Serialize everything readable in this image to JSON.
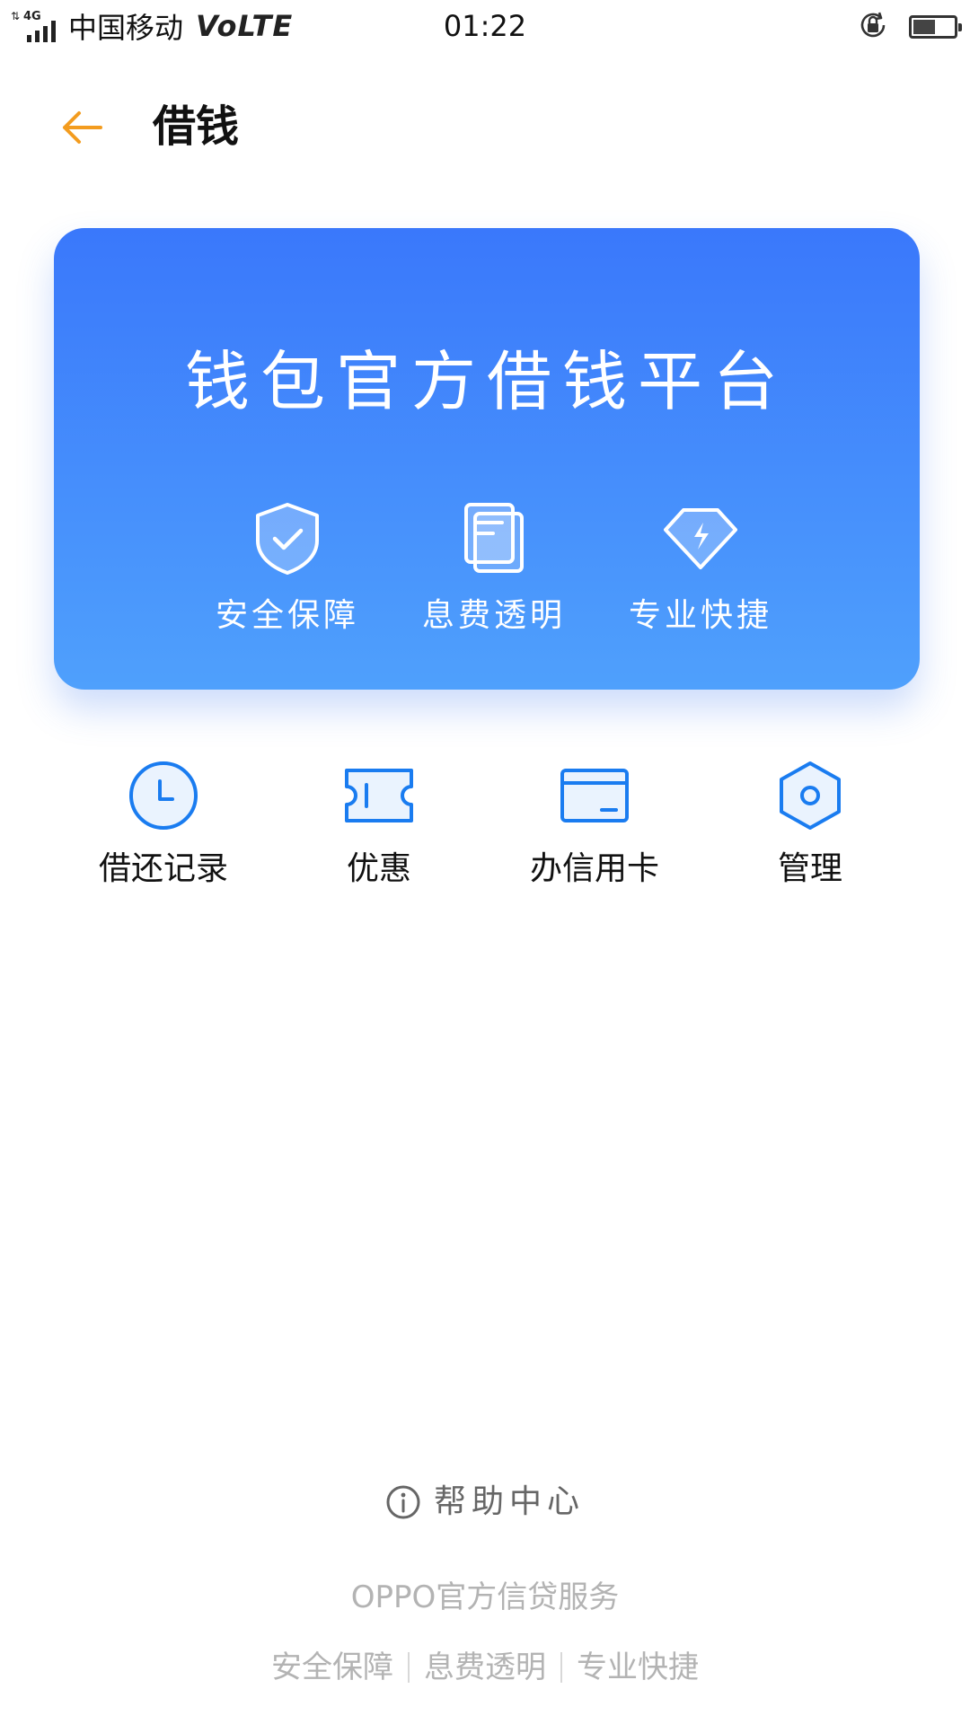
{
  "status_bar": {
    "network_type": "4G",
    "network_arrows": "⇅",
    "carrier": "中国移动",
    "volte": "VoLTE",
    "time": "01:22",
    "battery_level": 0.55
  },
  "header": {
    "title": "借钱",
    "back_icon": "back-arrow-icon",
    "back_color": "#f39c1f"
  },
  "banner": {
    "title": "钱包官方借钱平台",
    "features": [
      {
        "label": "安全保障",
        "icon": "shield-check-icon"
      },
      {
        "label": "息费透明",
        "icon": "document-icon"
      },
      {
        "label": "专业快捷",
        "icon": "diamond-lightning-icon"
      }
    ],
    "gradient": [
      "#3a78fb",
      "#4fa0fc"
    ]
  },
  "quick_actions": [
    {
      "label": "借还记录",
      "icon": "clock-icon"
    },
    {
      "label": "优惠",
      "icon": "coupon-icon"
    },
    {
      "label": "办信用卡",
      "icon": "credit-card-icon"
    },
    {
      "label": "管理",
      "icon": "settings-hexagon-icon"
    }
  ],
  "accent_color": "#1a7cf0",
  "footer": {
    "help_label": "帮助中心",
    "help_icon": "info-icon",
    "brand_text": "OPPO官方信贷服务",
    "tags": [
      "安全保障",
      "息费透明",
      "专业快捷"
    ]
  }
}
